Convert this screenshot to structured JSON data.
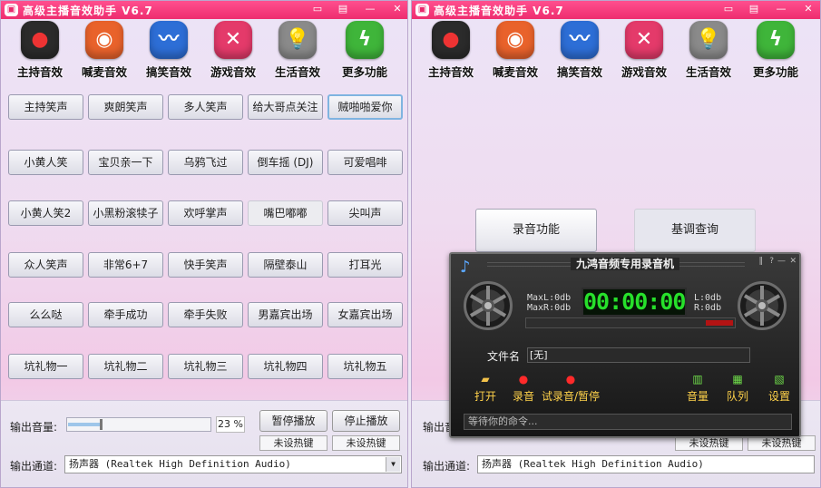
{
  "app": {
    "title": "高级主播音效助手 V6.7",
    "icon_glyph": "▣"
  },
  "toolbar": [
    {
      "label": "主持音效",
      "icon": "record-icon",
      "glyph": "●",
      "color": "#2b2b2b"
    },
    {
      "label": "喊麦音效",
      "icon": "ubuntu-icon",
      "glyph": "◉",
      "color": "#e9622b"
    },
    {
      "label": "搞笑音效",
      "icon": "waveform-icon",
      "glyph": "〰",
      "color": "#2d6ed6"
    },
    {
      "label": "游戏音效",
      "icon": "x-icon",
      "glyph": "✕",
      "color": "#e43a6a"
    },
    {
      "label": "生活音效",
      "icon": "lightbulb-icon",
      "glyph": "💡",
      "color": "#8a8a8a"
    },
    {
      "label": "更多功能",
      "icon": "lightning-icon",
      "glyph": "ϟ",
      "color": "#3fb53a"
    }
  ],
  "sound_buttons": [
    [
      "主持笑声",
      "爽朗笑声",
      "多人笑声",
      "给大哥点关注",
      "贼啪啪爱你"
    ],
    [
      "小黄人笑",
      "宝贝亲一下",
      "乌鸦飞过",
      "倒车摇 (DJ)",
      "可爱唱啡"
    ],
    [
      "小黄人笑2",
      "小黑粉滚犊子",
      "欢呼掌声",
      "嘴巴嘟嘟",
      "尖叫声"
    ],
    [
      "众人笑声",
      "非常6+7",
      "快手笑声",
      "隔壁泰山",
      "打耳光"
    ],
    [
      "么么哒",
      "牵手成功",
      "牵手失败",
      "男嘉宾出场",
      "女嘉宾出场"
    ],
    [
      "坑礼物一",
      "坑礼物二",
      "坑礼物三",
      "坑礼物四",
      "坑礼物五"
    ]
  ],
  "bottom": {
    "volume_label": "输出音量:",
    "volume_value": "23 %",
    "volume_fraction": 0.23,
    "pause_label": "暂停播放",
    "stop_label": "停止播放",
    "hotkey_unset": "未设热键",
    "channel_label": "输出通道:",
    "channel_value": "扬声器 (Realtek High Definition Audio)",
    "right_volume_label": "输出音",
    "right_channel_label": "输出通道:",
    "right_hotkey_1": "未设热键",
    "right_hotkey_2": "未设热键"
  },
  "more_panel": {
    "record_label": "录音功能",
    "key_label": "基调查询"
  },
  "recorder": {
    "title": "九鸿音频专用录音机",
    "max_l": "MaxL:0db",
    "max_r": "MaxR:0db",
    "time": "00:00:00",
    "l": "L:0db",
    "r": "R:0db",
    "file_label": "文件名",
    "file_value": "[无]",
    "tools": [
      {
        "label": "打开",
        "icon": "folder-icon",
        "glyph": "📂"
      },
      {
        "label": "录音",
        "icon": "record-dot-icon",
        "glyph": "●"
      },
      {
        "label": "试录音/暂停",
        "icon": "test-record-icon",
        "glyph": "●"
      },
      {
        "label": "音量",
        "icon": "volume-icon",
        "glyph": "▥"
      },
      {
        "label": "队列",
        "icon": "queue-icon",
        "glyph": "▦"
      },
      {
        "label": "设置",
        "icon": "settings-icon",
        "glyph": "▧"
      }
    ],
    "status": "等待你的命令..."
  }
}
